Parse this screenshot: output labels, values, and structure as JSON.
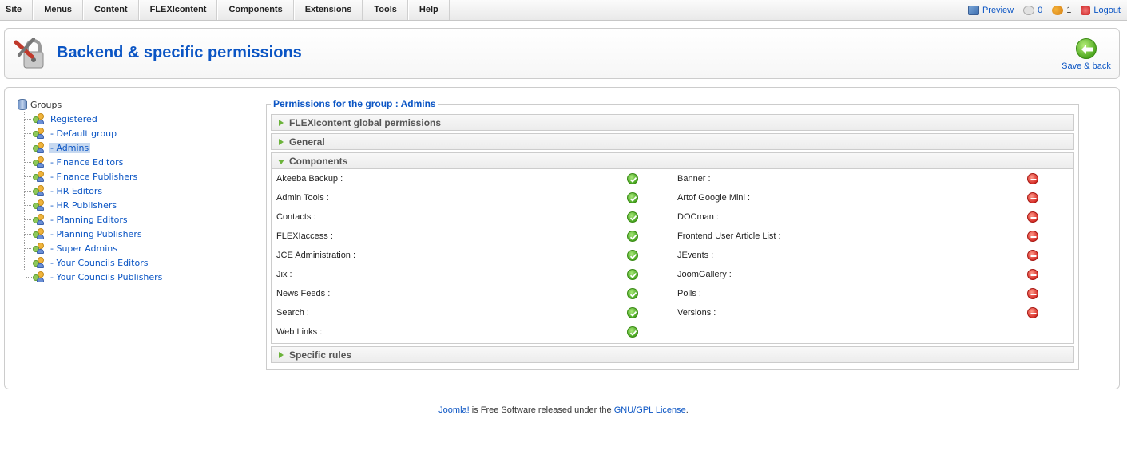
{
  "menu": [
    "Site",
    "Menus",
    "Content",
    "FLEXIcontent",
    "Components",
    "Extensions",
    "Tools",
    "Help"
  ],
  "status": {
    "preview": "Preview",
    "messages": "0",
    "users_online": "1",
    "logout": "Logout"
  },
  "header": {
    "title": "Backend & specific permissions",
    "save_back": "Save & back"
  },
  "tree": {
    "root": "Groups",
    "items": [
      {
        "label": "Registered",
        "selected": false
      },
      {
        "label": "- Default group",
        "selected": false
      },
      {
        "label": "- Admins",
        "selected": true
      },
      {
        "label": "- Finance Editors",
        "selected": false
      },
      {
        "label": "- Finance Publishers",
        "selected": false
      },
      {
        "label": "- HR Editors",
        "selected": false
      },
      {
        "label": "- HR Publishers",
        "selected": false
      },
      {
        "label": "- Planning Editors",
        "selected": false
      },
      {
        "label": "- Planning Publishers",
        "selected": false
      },
      {
        "label": "- Super Admins",
        "selected": false
      },
      {
        "label": "- Your Councils Editors",
        "selected": false
      },
      {
        "label": "- Your Councils Publishers",
        "selected": false
      }
    ]
  },
  "permissions": {
    "legend": "Permissions for the group : Admins",
    "panels": {
      "global": "FLEXIcontent global permissions",
      "general": "General",
      "components": "Components",
      "specific": "Specific rules"
    },
    "components_left": [
      {
        "name": "Akeeba Backup :",
        "allowed": true
      },
      {
        "name": "Admin Tools :",
        "allowed": true
      },
      {
        "name": "Contacts :",
        "allowed": true
      },
      {
        "name": "FLEXIaccess :",
        "allowed": true
      },
      {
        "name": "JCE Administration :",
        "allowed": true
      },
      {
        "name": "Jix :",
        "allowed": true
      },
      {
        "name": "News Feeds :",
        "allowed": true
      },
      {
        "name": "Search :",
        "allowed": true
      },
      {
        "name": "Web Links :",
        "allowed": true
      }
    ],
    "components_right": [
      {
        "name": "Banner :",
        "allowed": false
      },
      {
        "name": "Artof Google Mini :",
        "allowed": false
      },
      {
        "name": "DOCman :",
        "allowed": false
      },
      {
        "name": "Frontend User Article List :",
        "allowed": false
      },
      {
        "name": "JEvents :",
        "allowed": false
      },
      {
        "name": "JoomGallery :",
        "allowed": false
      },
      {
        "name": "Polls :",
        "allowed": false
      },
      {
        "name": "Versions :",
        "allowed": false
      }
    ]
  },
  "footer": {
    "joomla_link": "Joomla!",
    "middle": " is Free Software released under the ",
    "license_link": "GNU/GPL License",
    "end": "."
  }
}
